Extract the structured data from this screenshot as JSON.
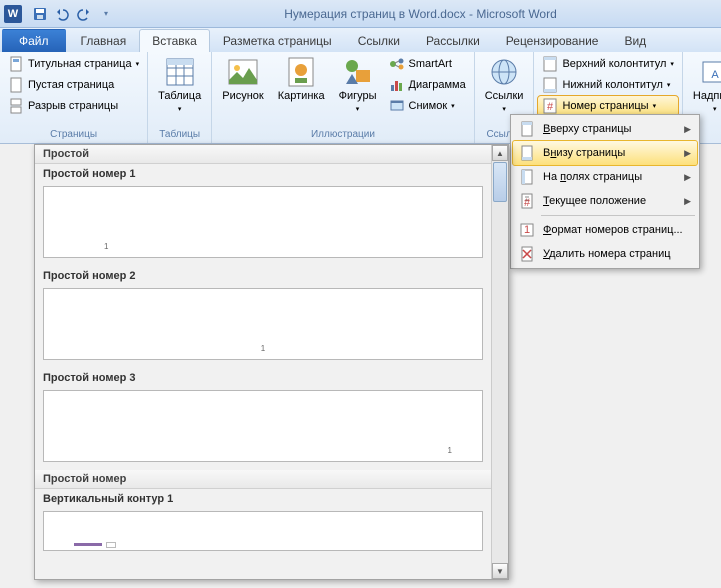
{
  "title": "Нумерация страниц в Word.docx - Microsoft Word",
  "tabs": {
    "file": "Файл",
    "home": "Главная",
    "insert": "Вставка",
    "layout": "Разметка страницы",
    "references": "Ссылки",
    "mailings": "Рассылки",
    "review": "Рецензирование",
    "view": "Вид"
  },
  "groups": {
    "pages": {
      "label": "Страницы",
      "cover": "Титульная страница",
      "blank": "Пустая страница",
      "break": "Разрыв страницы"
    },
    "tables": {
      "label": "Таблицы",
      "table": "Таблица"
    },
    "illustrations": {
      "label": "Иллюстрации",
      "picture": "Рисунок",
      "clipart": "Картинка",
      "shapes": "Фигуры",
      "smartart": "SmartArt",
      "chart": "Диаграмма",
      "screenshot": "Снимок"
    },
    "links": {
      "label": "Ссылки",
      "links": "Ссылки"
    },
    "header_footer": {
      "header": "Верхний колонтитул",
      "footer": "Нижний колонтитул",
      "page_number": "Номер страницы"
    },
    "text": {
      "textbox": "Надпись"
    }
  },
  "menu": {
    "top": "Вверху страницы",
    "bottom": "Внизу страницы",
    "margins": "На полях страницы",
    "current": "Текущее положение",
    "format": "Формат номеров страниц...",
    "remove": "Удалить номера страниц"
  },
  "gallery": {
    "section1": "Простой",
    "item1": "Простой номер 1",
    "item2": "Простой номер 2",
    "item3": "Простой номер 3",
    "section2": "Простой номер",
    "item4": "Вертикальный контур 1",
    "num": "1"
  }
}
